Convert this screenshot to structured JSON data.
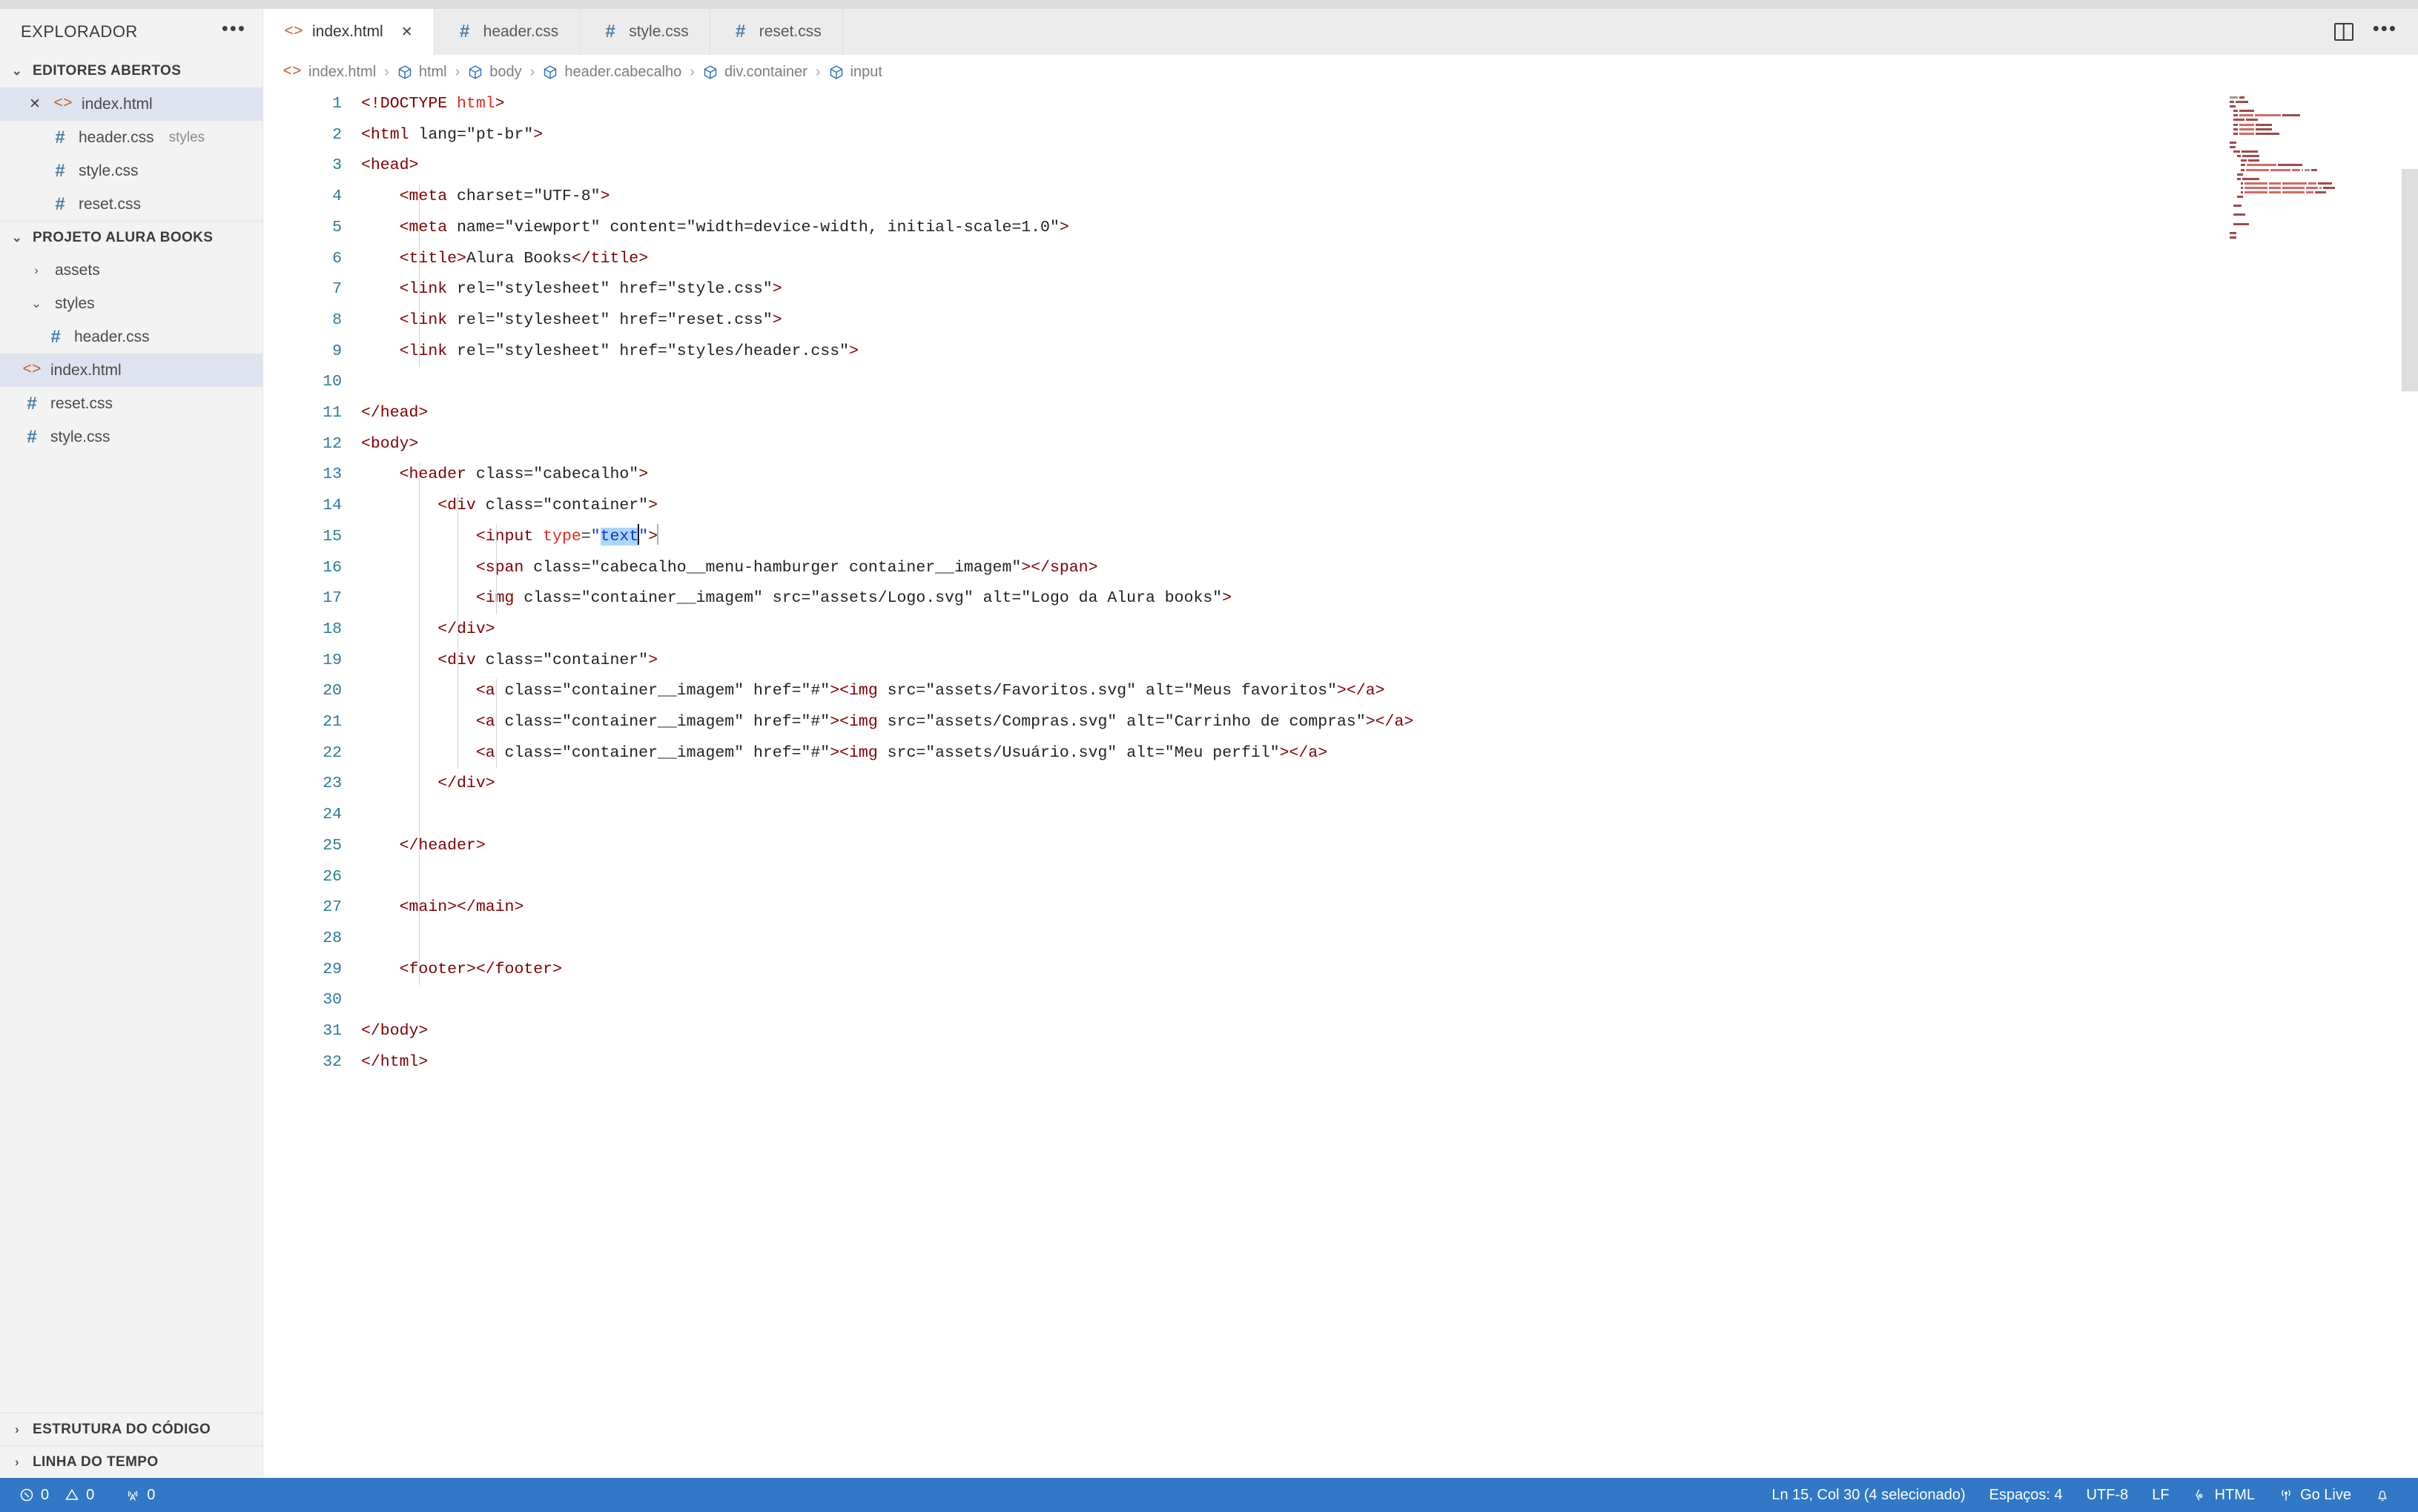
{
  "sidebar": {
    "title": "EXPLORADOR",
    "more_icon": "ellipsis-icon",
    "open_editors": {
      "label": "EDITORES ABERTOS",
      "items": [
        {
          "name": "index.html",
          "icon": "html-file-icon",
          "desc": "",
          "selected": true,
          "close": "×"
        },
        {
          "name": "header.css",
          "icon": "css-file-icon",
          "desc": "styles",
          "selected": false
        },
        {
          "name": "style.css",
          "icon": "css-file-icon",
          "desc": "",
          "selected": false
        },
        {
          "name": "reset.css",
          "icon": "css-file-icon",
          "desc": "",
          "selected": false
        }
      ]
    },
    "project": {
      "label": "PROJETO ALURA BOOKS",
      "items": [
        {
          "name": "assets",
          "icon": "folder-collapsed-icon",
          "type": "folder",
          "expanded": false,
          "indent": 1
        },
        {
          "name": "styles",
          "icon": "folder-expanded-icon",
          "type": "folder",
          "expanded": true,
          "indent": 1
        },
        {
          "name": "header.css",
          "icon": "css-file-icon",
          "type": "file",
          "indent": 2
        },
        {
          "name": "index.html",
          "icon": "html-file-icon",
          "type": "file",
          "indent": 1,
          "selected": true
        },
        {
          "name": "reset.css",
          "icon": "css-file-icon",
          "type": "file",
          "indent": 1
        },
        {
          "name": "style.css",
          "icon": "css-file-icon",
          "type": "file",
          "indent": 1
        }
      ]
    },
    "bottom_sections": [
      {
        "label": "ESTRUTURA DO CÓDIGO",
        "expanded": false
      },
      {
        "label": "LINHA DO TEMPO",
        "expanded": false
      }
    ]
  },
  "tabs": [
    {
      "label": "index.html",
      "icon": "html-file-icon",
      "active": true,
      "close": "×"
    },
    {
      "label": "header.css",
      "icon": "css-file-icon",
      "active": false
    },
    {
      "label": "style.css",
      "icon": "css-file-icon",
      "active": false
    },
    {
      "label": "reset.css",
      "icon": "css-file-icon",
      "active": false
    }
  ],
  "tab_actions": [
    {
      "name": "split-editor-icon"
    },
    {
      "name": "more-actions-icon",
      "label": "..."
    }
  ],
  "breadcrumb": [
    {
      "label": "index.html",
      "icon": "html-file-icon"
    },
    {
      "label": "html",
      "icon": "symbol-cube-icon"
    },
    {
      "label": "body",
      "icon": "symbol-cube-icon"
    },
    {
      "label": "header.cabecalho",
      "icon": "symbol-cube-icon"
    },
    {
      "label": "div.container",
      "icon": "symbol-cube-icon"
    },
    {
      "label": "input",
      "icon": "symbol-cube-icon"
    }
  ],
  "editor": {
    "language": "HTML",
    "first_line": 1,
    "last_line": 32,
    "lines": [
      "<!DOCTYPE html>",
      "<html lang=\"pt-br\">",
      "<head>",
      "    <meta charset=\"UTF-8\">",
      "    <meta name=\"viewport\" content=\"width=device-width, initial-scale=1.0\">",
      "    <title>Alura Books</title>",
      "    <link rel=\"stylesheet\" href=\"style.css\">",
      "    <link rel=\"stylesheet\" href=\"reset.css\">",
      "    <link rel=\"stylesheet\" href=\"styles/header.css\">",
      "",
      "</head>",
      "<body>",
      "    <header class=\"cabecalho\">",
      "        <div class=\"container\">",
      "            <input type=\"text\">",
      "            <span class=\"cabecalho__menu-hamburger container__imagem\"></span>",
      "            <img class=\"container__imagem\" src=\"assets/Logo.svg\" alt=\"Logo da Alura books\">",
      "        </div>",
      "        <div class=\"container\">",
      "            <a class=\"container__imagem\" href=\"#\"><img src=\"assets/Favoritos.svg\" alt=\"Meus favoritos\"></a>",
      "            <a class=\"container__imagem\" href=\"#\"><img src=\"assets/Compras.svg\" alt=\"Carrinho de compras\"></a>",
      "            <a class=\"container__imagem\" href=\"#\"><img src=\"assets/Usuário.svg\" alt=\"Meu perfil\"></a>",
      "        </div>",
      "",
      "    </header>",
      "",
      "    <main></main>",
      "",
      "    <footer></footer>",
      "",
      "</body>",
      "</html>"
    ],
    "selection_text": "text",
    "cursor_line": 15,
    "cursor_col": 30
  },
  "statusbar": {
    "errors": {
      "icon": "error-circle-icon",
      "count": "0"
    },
    "warnings": {
      "icon": "warning-triangle-icon",
      "count": "0"
    },
    "ports": {
      "icon": "radio-tower-icon",
      "count": "0"
    },
    "position": "Ln 15, Col 30 (4 selecionado)",
    "indentation": "Espaços: 4",
    "encoding": "UTF-8",
    "eol": "LF",
    "language": "HTML",
    "language_icon": "braces-icon",
    "go_live": "Go Live",
    "go_live_icon": "broadcast-icon",
    "bell_icon": "bell-icon"
  },
  "colors": {
    "accent": "#3178c6",
    "tag": "#800000",
    "attribute": "#e02a22",
    "value": "#0b35d8",
    "line_number": "#2b7a9b",
    "selection": "#add6ff",
    "sidebar_bg": "#f3f3f3",
    "tab_inactive_bg": "#ececec",
    "tree_selected_bg": "#dfe3ef"
  }
}
